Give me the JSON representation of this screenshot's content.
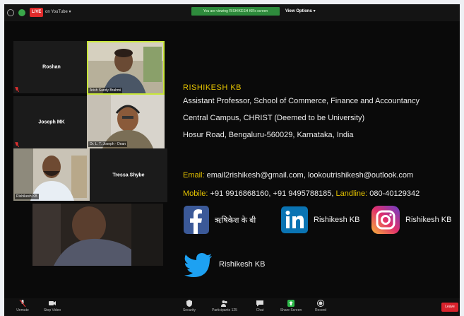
{
  "topbar": {
    "live_badge": "LIVE",
    "youtube_label": "on YouTube ▾",
    "viewing_banner": "You are viewing RISHIKESH KB's screen",
    "view_options": "View Options ▾"
  },
  "gallery": {
    "tiles": [
      {
        "name": "Roshan"
      },
      {
        "label": "Arish Sandy Brahmi"
      },
      {
        "name": "Joseph MK"
      },
      {
        "label": "Dr. L. T. Joseph - Dean"
      },
      {
        "label": "Rishikesh KB"
      },
      {
        "name": "Tressa Shybe"
      }
    ]
  },
  "profile": {
    "name": "RISHIKESH KB",
    "title": "Assistant Professor, School of Commerce, Finance and Accountancy",
    "campus": "Central Campus, CHRIST (Deemed to be University)",
    "address": "Hosur Road, Bengaluru-560029, Karnataka, India"
  },
  "contact": {
    "email_label": "Email:",
    "email_value": " email2rishikesh@gmail.com, lookoutrishikesh@outlook.com",
    "mobile_label": "Mobile:",
    "mobile_value": " +91 9916868160, +91 9495788185,",
    "landline_label": " Landline:",
    "landline_value": " 080-40129342"
  },
  "social": {
    "facebook": "ऋषिकेश के बी",
    "linkedin": "Rishikesh KB",
    "instagram": "Rishikesh KB",
    "twitter": "Rishikesh KB"
  },
  "toolbar": {
    "unmute": "Unmute",
    "stop_video": "Stop Video",
    "security": "Security",
    "participants": "Participants",
    "participants_count": "125",
    "chat": "Chat",
    "share_screen": "Share Screen",
    "record": "Record",
    "leave": "Leave"
  },
  "colors": {
    "accent_yellow": "#e6c400",
    "active_border": "#c8e63a",
    "live_red": "#e02b2b",
    "share_green": "#2e8b3c",
    "facebook_blue": "#3b5998",
    "linkedin_blue": "#0a74b3",
    "twitter_blue": "#1da1f2"
  }
}
